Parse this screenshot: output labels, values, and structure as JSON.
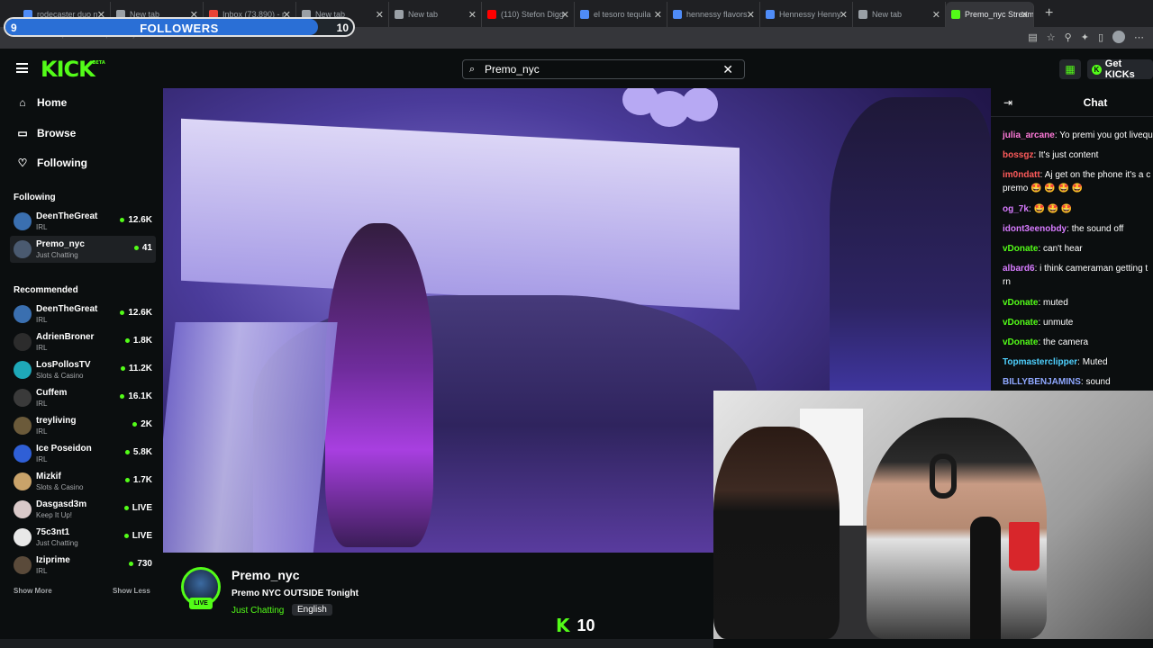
{
  "browser": {
    "tabs": [
      {
        "title": "rodecaster duo n",
        "color": "#4f8cf7"
      },
      {
        "title": "New tab",
        "color": "#9aa0a6"
      },
      {
        "title": "Inbox (73,890) - r",
        "color": "#ea4335"
      },
      {
        "title": "New tab",
        "color": "#9aa0a6"
      },
      {
        "title": "New tab",
        "color": "#9aa0a6"
      },
      {
        "title": "(110) Stefon Digg",
        "color": "#ff0000"
      },
      {
        "title": "el tesoro tequila",
        "color": "#4f8cf7"
      },
      {
        "title": "hennessy flavors",
        "color": "#4f8cf7"
      },
      {
        "title": "Hennessy Henny",
        "color": "#4f8cf7"
      },
      {
        "title": "New tab",
        "color": "#9aa0a6"
      },
      {
        "title": "Premo_nyc Stream",
        "color": "#53fc18",
        "active": true
      }
    ],
    "url": "https://kick.com/premo-nyc"
  },
  "followers_goal": {
    "label": "FOLLOWERS",
    "current": "9",
    "target": "10",
    "progress": 0.9
  },
  "header": {
    "logo": "KICK",
    "logo_badge": "BETA",
    "search_value": "Premo_nyc",
    "get_kicks": "Get KICKs"
  },
  "sidebar": {
    "nav": [
      {
        "label": "Home",
        "icon": "home-icon"
      },
      {
        "label": "Browse",
        "icon": "browse-icon"
      },
      {
        "label": "Following",
        "icon": "heart-icon"
      }
    ],
    "following_title": "Following",
    "following": [
      {
        "name": "DeenTheGreat",
        "category": "IRL",
        "viewers": "12.6K",
        "avatar": "#3a6fb0"
      },
      {
        "name": "Premo_nyc",
        "category": "Just Chatting",
        "viewers": "41",
        "avatar": "#4a5a70",
        "selected": true
      }
    ],
    "recommended_title": "Recommended",
    "recommended": [
      {
        "name": "DeenTheGreat",
        "category": "IRL",
        "viewers": "12.6K",
        "avatar": "#3a6fb0"
      },
      {
        "name": "AdrienBroner",
        "category": "IRL",
        "viewers": "1.8K",
        "avatar": "#2c2c2c"
      },
      {
        "name": "LosPollosTV",
        "category": "Slots & Casino",
        "viewers": "11.2K",
        "avatar": "#1ea8b8"
      },
      {
        "name": "Cuffem",
        "category": "IRL",
        "viewers": "16.1K",
        "avatar": "#3a3a3a"
      },
      {
        "name": "treyliving",
        "category": "IRL",
        "viewers": "2K",
        "avatar": "#6b5a3a"
      },
      {
        "name": "Ice Poseidon",
        "category": "IRL",
        "viewers": "5.8K",
        "avatar": "#2f5fd6"
      },
      {
        "name": "Mizkif",
        "category": "Slots & Casino",
        "viewers": "1.7K",
        "avatar": "#c9a36a"
      },
      {
        "name": "Dasgasd3m",
        "category": "Keep It Up!",
        "viewers": "LIVE",
        "avatar": "#d9c9c9"
      },
      {
        "name": "75c3nt1",
        "category": "Just Chatting",
        "viewers": "LIVE",
        "avatar": "#e8e8e8"
      },
      {
        "name": "Iziprime",
        "category": "IRL",
        "viewers": "730",
        "avatar": "#5a4a3a"
      }
    ],
    "show_more": "Show More",
    "show_less": "Show Less"
  },
  "chat": {
    "title": "Chat",
    "messages": [
      {
        "user": "julia_arcane",
        "color": "#ff7ad9",
        "text": "Yo premi you got livequ"
      },
      {
        "user": "bossgz",
        "color": "#ff5b5b",
        "text": "It's just content"
      },
      {
        "user": "im0ndatt",
        "color": "#ff5b5b",
        "text": "Aj get on the phone it's a c premo 🤩 🤩 🤩 🤩"
      },
      {
        "user": "og_7k",
        "color": "#d77bff",
        "text": "🤩 🤩 🤩"
      },
      {
        "user": "idont3eenobdy",
        "color": "#d77bff",
        "text": "the sound off"
      },
      {
        "user": "vDonate",
        "color": "#53fc18",
        "text": "can't hear"
      },
      {
        "user": "albard6",
        "color": "#d77bff",
        "text": "i think cameraman getting t rn"
      },
      {
        "user": "vDonate",
        "color": "#53fc18",
        "text": "muted"
      },
      {
        "user": "vDonate",
        "color": "#53fc18",
        "text": "unmute"
      },
      {
        "user": "vDonate",
        "color": "#53fc18",
        "text": "the camera"
      },
      {
        "user": "Topmasterclipper",
        "color": "#4fd1ff",
        "text": "Muted"
      },
      {
        "user": "BILLYBENJAMINS",
        "color": "#8fa8ff",
        "text": "sound"
      }
    ]
  },
  "stream": {
    "streamer": "Premo_nyc",
    "title": "Premo NYC OUTSIDE Tonight",
    "category": "Just Chatting",
    "language": "English",
    "live_badge": "LIVE",
    "kick_count": "10"
  },
  "colors": {
    "accent": "#53fc18",
    "background": "#0b0e0f"
  }
}
